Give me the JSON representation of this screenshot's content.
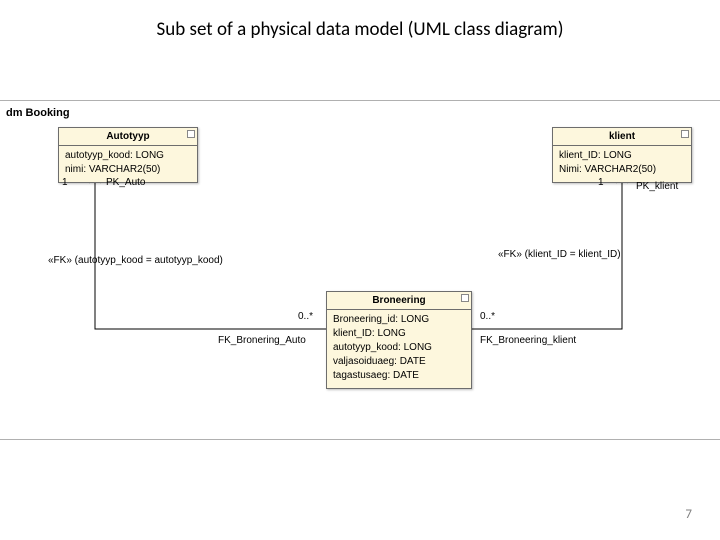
{
  "title": "Sub set of a physical data model (UML class diagram)",
  "package_label": "dm Booking",
  "classes": {
    "autotyyp": {
      "name": "Autotyyp",
      "attrs": [
        "autotyyp_kood: LONG",
        "nimi: VARCHAR2(50)"
      ]
    },
    "klient": {
      "name": "klient",
      "attrs": [
        "klient_ID: LONG",
        "Nimi: VARCHAR2(50)"
      ]
    },
    "broneering": {
      "name": "Broneering",
      "attrs": [
        "Broneering_id: LONG",
        "klient_ID: LONG",
        "autotyyp_kood: LONG",
        "valjasoiduaeg: DATE",
        "tagastusaeg: DATE"
      ]
    }
  },
  "assoc": {
    "left": {
      "mult_top": "1",
      "pk": "PK_Auto",
      "fk_text": "«FK» (autotyyp_kood = autotyyp_kood)",
      "mult_bottom": "0..*",
      "fk_name": "FK_Bronering_Auto"
    },
    "right": {
      "mult_top": "1",
      "pk": "PK_klient",
      "fk_text": "«FK» (klient_ID = klient_ID)",
      "mult_bottom": "0..*",
      "fk_name": "FK_Broneering_klient"
    }
  },
  "page_number": "7"
}
